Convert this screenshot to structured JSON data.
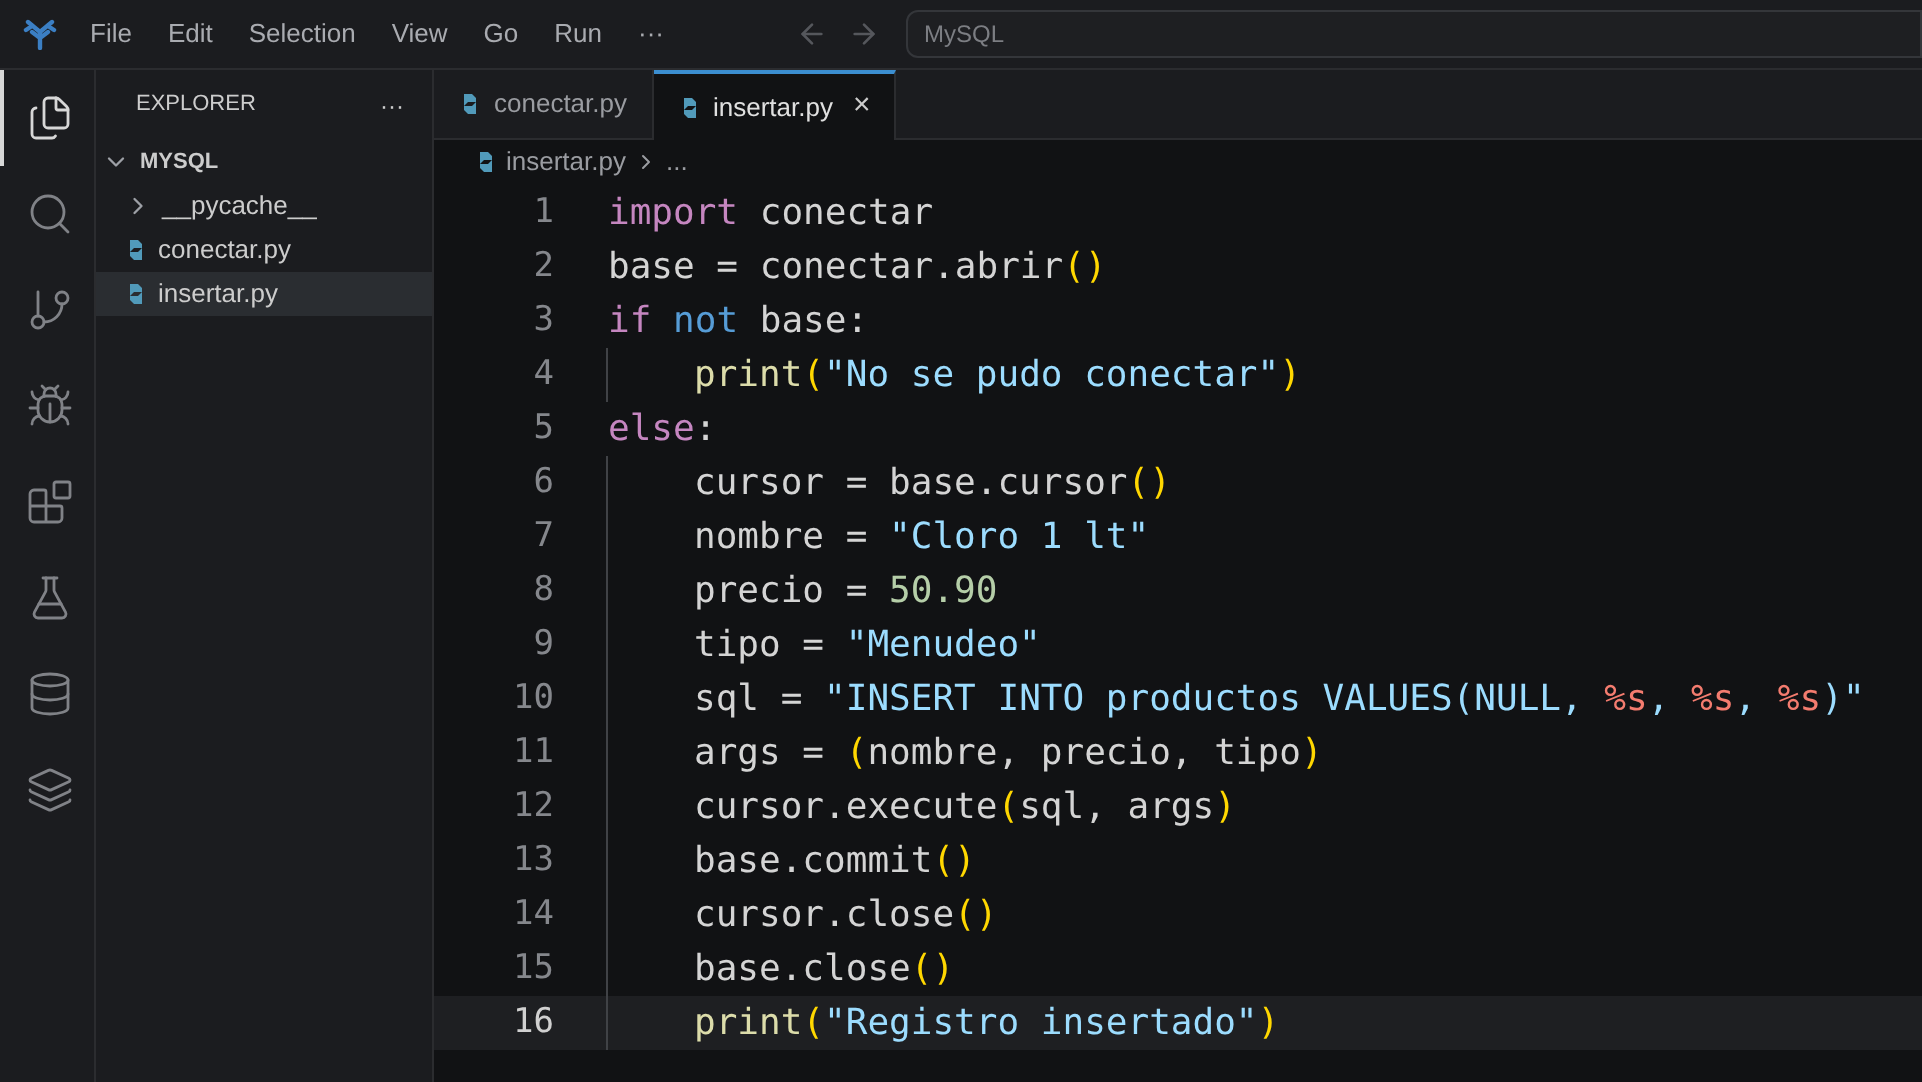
{
  "menu": [
    "File",
    "Edit",
    "Selection",
    "View",
    "Go",
    "Run",
    "···"
  ],
  "command_center": {
    "label": "MySQL"
  },
  "activity_bar": [
    {
      "selected": true
    },
    {
      "selected": false
    },
    {
      "selected": false
    },
    {
      "selected": false
    },
    {
      "selected": false
    },
    {
      "selected": false
    },
    {
      "selected": false
    },
    {
      "selected": false
    }
  ],
  "explorer": {
    "title": "EXPLORER",
    "more": "···",
    "tree": [
      {
        "label": "MYSQL",
        "kind": "root",
        "expanded": true,
        "selected": false,
        "children": [
          {
            "label": "__pycache__",
            "kind": "folder",
            "expanded": false,
            "selected": false
          },
          {
            "label": "conectar.py",
            "kind": "python",
            "selected": false
          },
          {
            "label": "insertar.py",
            "kind": "python",
            "selected": true
          }
        ]
      }
    ]
  },
  "tabs": [
    {
      "label": "conectar.py",
      "selected": false
    },
    {
      "label": "insertar.py",
      "selected": true,
      "close": "×"
    }
  ],
  "breadcrumb": {
    "file": "insertar.py",
    "rest": "..."
  },
  "code": [
    {
      "number": "1",
      "indent": false,
      "current": false,
      "tokens": [
        {
          "kind": "keyword",
          "text": "import"
        },
        {
          "kind": "plain",
          "text": " conectar"
        }
      ]
    },
    {
      "number": "2",
      "indent": false,
      "current": false,
      "tokens": [
        {
          "kind": "plain",
          "text": "base = conectar.abrir"
        },
        {
          "kind": "paren",
          "text": "()"
        }
      ]
    },
    {
      "number": "3",
      "indent": false,
      "current": false,
      "tokens": [
        {
          "kind": "keyword",
          "text": "if"
        },
        {
          "kind": "operator",
          "text": " not"
        },
        {
          "kind": "plain",
          "text": " base:"
        }
      ]
    },
    {
      "number": "4",
      "indent": true,
      "current": false,
      "tokens": [
        {
          "kind": "func",
          "text": "print"
        },
        {
          "kind": "paren",
          "text": "("
        },
        {
          "kind": "string",
          "text": "\"No se pudo conectar\""
        },
        {
          "kind": "paren",
          "text": ")"
        }
      ]
    },
    {
      "number": "5",
      "indent": false,
      "current": false,
      "tokens": [
        {
          "kind": "keyword",
          "text": "else"
        },
        {
          "kind": "plain",
          "text": ":"
        }
      ]
    },
    {
      "number": "6",
      "indent": true,
      "current": false,
      "tokens": [
        {
          "kind": "plain",
          "text": "cursor = base.cursor"
        },
        {
          "kind": "paren",
          "text": "()"
        }
      ]
    },
    {
      "number": "7",
      "indent": true,
      "current": false,
      "tokens": [
        {
          "kind": "plain",
          "text": "nombre = "
        },
        {
          "kind": "string",
          "text": "\"Cloro 1 lt\""
        }
      ]
    },
    {
      "number": "8",
      "indent": true,
      "current": false,
      "tokens": [
        {
          "kind": "plain",
          "text": "precio = "
        },
        {
          "kind": "number",
          "text": "50.90"
        }
      ]
    },
    {
      "number": "9",
      "indent": true,
      "current": false,
      "tokens": [
        {
          "kind": "plain",
          "text": "tipo = "
        },
        {
          "kind": "string",
          "text": "\"Menudeo\""
        }
      ]
    },
    {
      "number": "10",
      "indent": true,
      "current": false,
      "tokens": [
        {
          "kind": "plain",
          "text": "sql = "
        },
        {
          "kind": "string",
          "text": "\"INSERT INTO productos VALUES(NULL, "
        },
        {
          "kind": "format",
          "text": "%s"
        },
        {
          "kind": "string",
          "text": ", "
        },
        {
          "kind": "format",
          "text": "%s"
        },
        {
          "kind": "string",
          "text": ", "
        },
        {
          "kind": "format",
          "text": "%s"
        },
        {
          "kind": "string",
          "text": ")\""
        }
      ]
    },
    {
      "number": "11",
      "indent": true,
      "current": false,
      "tokens": [
        {
          "kind": "plain",
          "text": "args = "
        },
        {
          "kind": "paren",
          "text": "("
        },
        {
          "kind": "plain",
          "text": "nombre, precio, tipo"
        },
        {
          "kind": "paren",
          "text": ")"
        }
      ]
    },
    {
      "number": "12",
      "indent": true,
      "current": false,
      "tokens": [
        {
          "kind": "plain",
          "text": "cursor.execute"
        },
        {
          "kind": "paren",
          "text": "("
        },
        {
          "kind": "plain",
          "text": "sql, args"
        },
        {
          "kind": "paren",
          "text": ")"
        }
      ]
    },
    {
      "number": "13",
      "indent": true,
      "current": false,
      "tokens": [
        {
          "kind": "plain",
          "text": "base.commit"
        },
        {
          "kind": "paren",
          "text": "()"
        }
      ]
    },
    {
      "number": "14",
      "indent": true,
      "current": false,
      "tokens": [
        {
          "kind": "plain",
          "text": "cursor.close"
        },
        {
          "kind": "paren",
          "text": "()"
        }
      ]
    },
    {
      "number": "15",
      "indent": true,
      "current": false,
      "tokens": [
        {
          "kind": "plain",
          "text": "base.close"
        },
        {
          "kind": "paren",
          "text": "()"
        }
      ]
    },
    {
      "number": "16",
      "indent": true,
      "current": true,
      "tokens": [
        {
          "kind": "func",
          "text": "print"
        },
        {
          "kind": "paren",
          "text": "("
        },
        {
          "kind": "string",
          "text": "\"Registro insertado\""
        },
        {
          "kind": "paren",
          "text": ")"
        }
      ]
    }
  ]
}
